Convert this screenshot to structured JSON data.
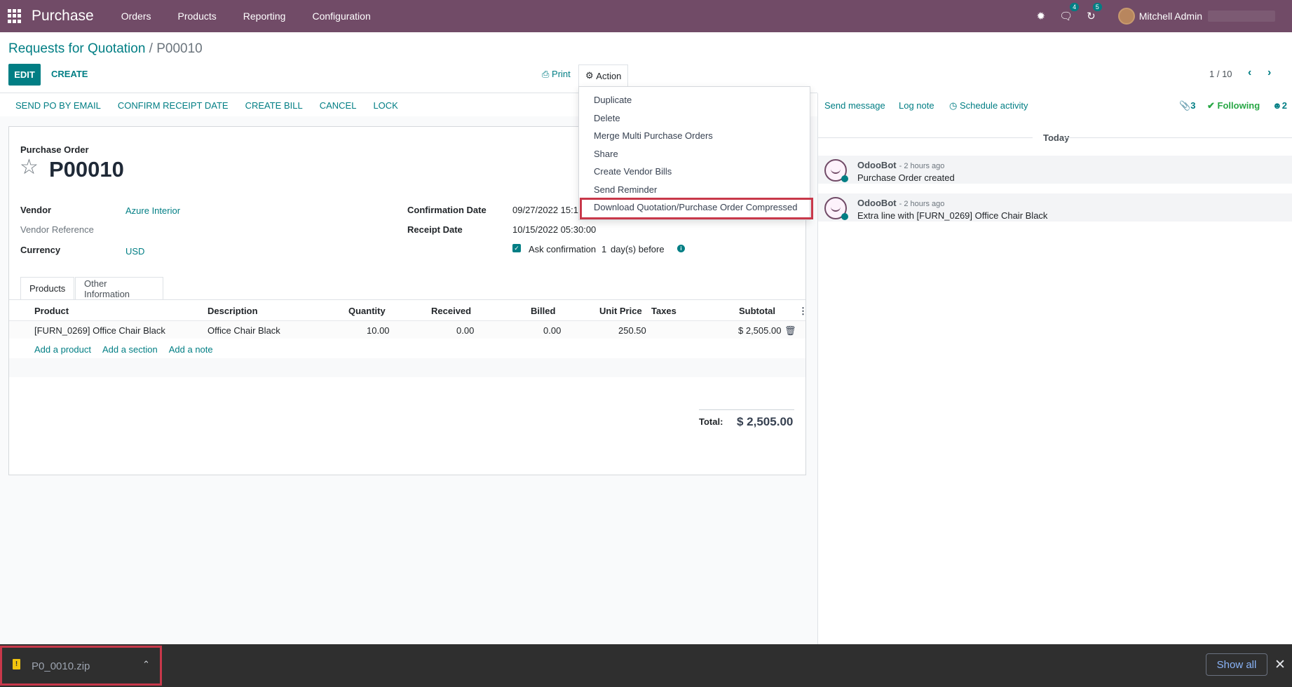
{
  "navbar": {
    "app_name": "Purchase",
    "menu": [
      "Orders",
      "Products",
      "Reporting",
      "Configuration"
    ],
    "messages_badge": "4",
    "activities_badge": "5",
    "user_name": "Mitchell Admin"
  },
  "breadcrumb": {
    "parent": "Requests for Quotation",
    "separator": "/",
    "current": "P00010"
  },
  "control_panel": {
    "edit_label": "EDIT",
    "create_label": "CREATE",
    "print_label": "Print",
    "action_label": "Action",
    "pager_value": "1 / 10"
  },
  "statusbar": {
    "buttons": [
      "SEND PO BY EMAIL",
      "CONFIRM RECEIPT DATE",
      "CREATE BILL",
      "CANCEL",
      "LOCK"
    ]
  },
  "form": {
    "type_label": "Purchase Order",
    "name": "P00010",
    "vendor_label": "Vendor",
    "vendor_value": "Azure Interior",
    "vendor_ref_label": "Vendor Reference",
    "currency_label": "Currency",
    "currency_value": "USD",
    "confirmation_label": "Confirmation Date",
    "confirmation_value": "09/27/2022 15:1",
    "receipt_label": "Receipt Date",
    "receipt_value": "10/15/2022 05:30:00",
    "ask_confirmation_label": "Ask confirmation",
    "ask_days": "1",
    "ask_suffix": "day(s) before"
  },
  "tabs": [
    "Products",
    "Other Information"
  ],
  "table": {
    "headers": [
      "Product",
      "Description",
      "Quantity",
      "Received",
      "Billed",
      "Unit Price",
      "Taxes",
      "Subtotal"
    ],
    "rows": [
      {
        "product": "[FURN_0269] Office Chair Black",
        "description": "Office Chair Black",
        "quantity": "10.00",
        "received": "0.00",
        "billed": "0.00",
        "unit_price": "250.50",
        "taxes": "",
        "subtotal": "$ 2,505.00"
      }
    ],
    "add_links": [
      "Add a product",
      "Add a section",
      "Add a note"
    ],
    "total_label": "Total:",
    "total_value": "$ 2,505.00"
  },
  "action_menu": {
    "items": [
      "Duplicate",
      "Delete",
      "Merge Multi Purchase Orders",
      "Share",
      "Create Vendor Bills",
      "Send Reminder",
      "Download Quotation/Purchase Order Compressed"
    ]
  },
  "chatter": {
    "send_message": "Send message",
    "log_note": "Log note",
    "schedule_activity": "Schedule activity",
    "attachments_count": "3",
    "following_label": "Following",
    "followers_count": "2",
    "date_separator": "Today",
    "messages": [
      {
        "author": "OdooBot",
        "time": "- 2 hours ago",
        "body": "Purchase Order created"
      },
      {
        "author": "OdooBot",
        "time": "- 2 hours ago",
        "body": "Extra line with [FURN_0269] Office Chair Black"
      }
    ]
  },
  "download_bar": {
    "file_name": "P0_0010.zip",
    "show_all_label": "Show all"
  },
  "colors": {
    "brand": "#714B67",
    "accent": "#017e84",
    "highlight": "#c8384a"
  }
}
